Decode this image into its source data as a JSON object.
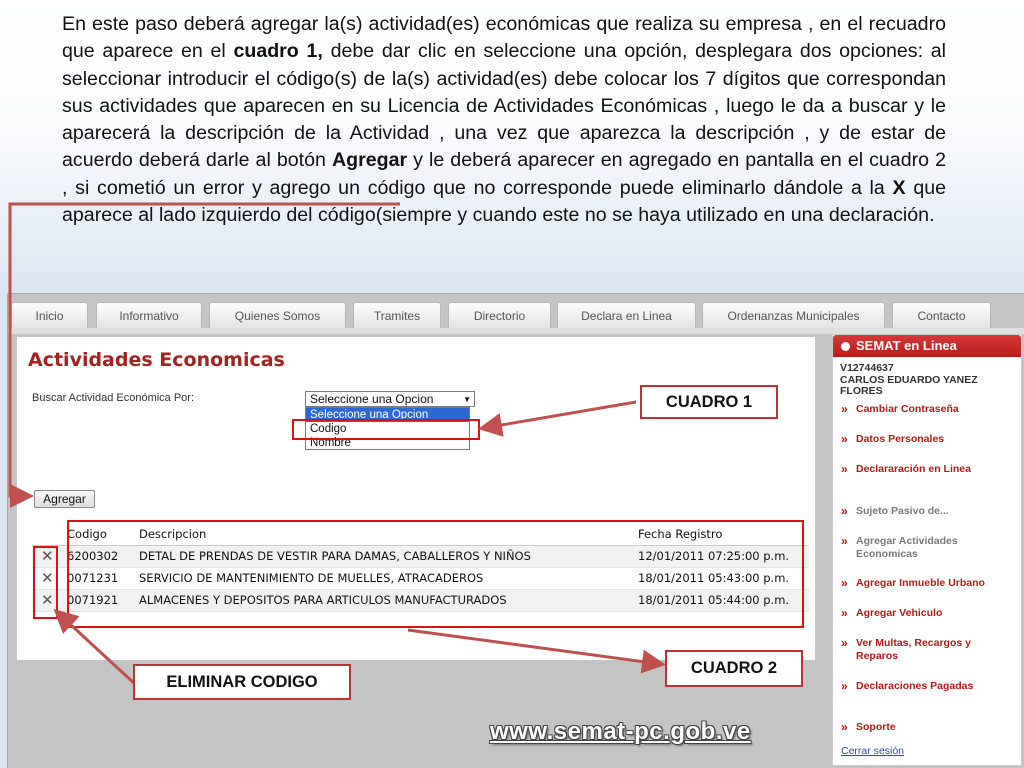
{
  "instruction": {
    "p01": "En este paso ",
    "p02": "deberá",
    "p03": " agregar la(s) actividad(es) ",
    "p04": "económicas",
    "p05": " que realiza su empresa , en el recuadro que aparece en el ",
    "p06": "cuadro 1,",
    "p07": " debe dar clic en seleccione una ",
    "p08": "opción",
    "p09": ", desplegara dos opciones:  al seleccionar introducir el ",
    "p10": "código(s)",
    "p11": " de la(s) actividad(es) debe colocar los 7 ",
    "p12": "dígitos",
    "p13": " que correspondan sus actividades que aparecen en su Licencia de Actividades ",
    "p14": "Económicas",
    "p15": " , luego le da a buscar y le ",
    "p16": "aparecerá",
    "p17": " la ",
    "p18": "descripción",
    "p19": " de la Actividad , una vez que aparezca la ",
    "p20": "descripción",
    "p21": " , y de estar de acuerdo ",
    "p22": "deberá",
    "p23": " darle al ",
    "p24": "botón",
    "p25": " ",
    "p26": "Agregar",
    "p27": " y le ",
    "p28": "deberá",
    "p29": " aparecer en agregado en pantalla en el cuadro 2 , si ",
    "p30": "cometió",
    "p31": " un error y agrego un ",
    "p32": "código",
    "p33": " que no corresponde puede eliminarlo ",
    "p34": "dándole",
    "p35": " a la ",
    "p36": "X",
    "p37": " que aparece al lado izquierdo del ",
    "p38": "código(siempre",
    "p39": " y cuando este no se haya utilizado en una ",
    "p40": "declaración",
    "p41": "."
  },
  "nav": {
    "tabs": [
      "Inicio",
      "Informativo",
      "Quienes Somos",
      "Tramites",
      "Directorio",
      "Declara en Linea",
      "Ordenanzas Municipales",
      "Contacto"
    ]
  },
  "form": {
    "title": "Actividades Economicas",
    "search_label": "Buscar  Actividad Económica Por:",
    "select_value": "Seleccione una Opcion",
    "options": [
      "Seleccione una Opcion",
      "Codigo",
      "Nombre"
    ],
    "add_button": "Agregar"
  },
  "table": {
    "headers": {
      "codigo": "Codigo",
      "descripcion": "Descripcion",
      "fecha": "Fecha Registro"
    },
    "delete_glyph": "✕",
    "rows": [
      {
        "codigo": "6200302",
        "descripcion": "DETAL DE PRENDAS DE VESTIR PARA DAMAS, CABALLEROS Y NIÑOS",
        "fecha": "12/01/2011 07:25:00 p.m."
      },
      {
        "codigo": "0071231",
        "descripcion": "SERVICIO DE MANTENIMIENTO DE MUELLES, ATRACADEROS",
        "fecha": "18/01/2011 05:43:00 p.m."
      },
      {
        "codigo": "0071921",
        "descripcion": "ALMACENES Y DEPOSITOS PARA ARTICULOS MANUFACTURADOS",
        "fecha": "18/01/2011 05:44:00 p.m."
      }
    ]
  },
  "sidebar": {
    "title": "SEMAT en Linea",
    "user_id": "V12744637",
    "user_name_1": "CARLOS EDUARDO YANEZ",
    "user_name_2": "FLORES",
    "arrow": "»",
    "links": [
      "Cambiar Contraseña",
      "Datos Personales",
      "Declararación en Linea",
      "Sujeto Pasivo de...",
      "Agregar Actividades Economicas",
      "Agregar Inmueble Urbano",
      "Agregar Vehiculo",
      "Ver Multas, Recargos y Reparos",
      "Declaraciones Pagadas",
      "Soporte"
    ],
    "logout": "Cerrar sesión"
  },
  "annotations": {
    "cuadro1": "CUADRO 1",
    "cuadro2": "CUADRO 2",
    "eliminar": "ELIMINAR CODIGO",
    "url": "www.semat-pc.gob.ve"
  },
  "colors": {
    "accent_red": "#a32222",
    "annotation_red": "#d11111",
    "selection_blue": "#2a68d3"
  }
}
